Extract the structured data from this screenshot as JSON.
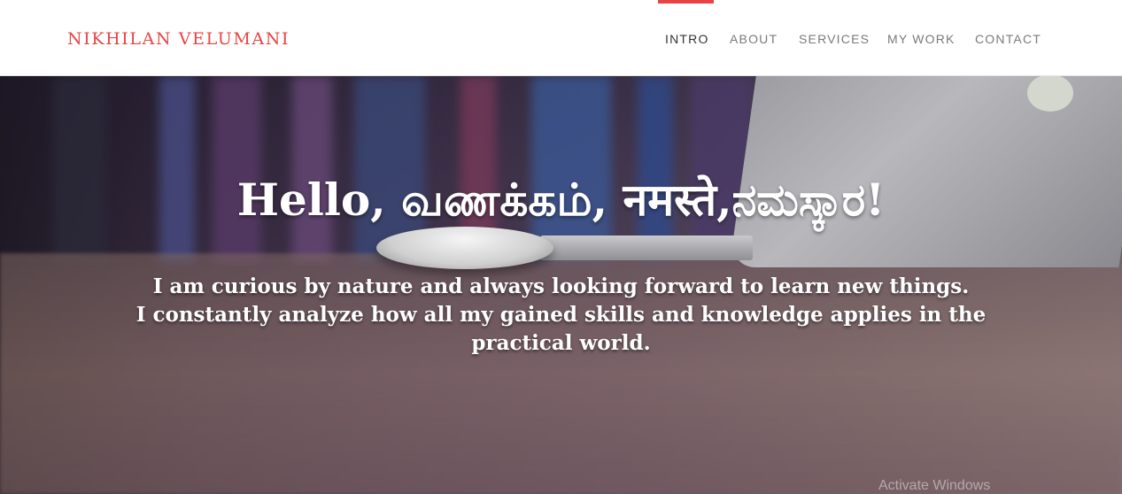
{
  "brand": {
    "name": "NIKHILAN VELUMANI"
  },
  "nav": {
    "items": [
      {
        "label": "INTRO",
        "active": true
      },
      {
        "label": "ABOUT",
        "active": false
      },
      {
        "label": "SERVICES",
        "active": false
      },
      {
        "label": "MY WORK",
        "active": false
      },
      {
        "label": "CONTACT",
        "active": false
      }
    ]
  },
  "hero": {
    "title": "Hello, வணக்கம், नमस्ते,ನಮಸ್ಕಾರ!",
    "subtitle_lines": [
      "I am curious by nature and always looking forward to learn new things.",
      "I constantly analyze how all my gained skills and knowledge applies in the",
      "practical world."
    ]
  },
  "overlay": {
    "watermark": "Activate Windows"
  },
  "colors": {
    "accent": "#e94343",
    "nav_text": "#7a7a7a",
    "nav_active": "#333333"
  }
}
